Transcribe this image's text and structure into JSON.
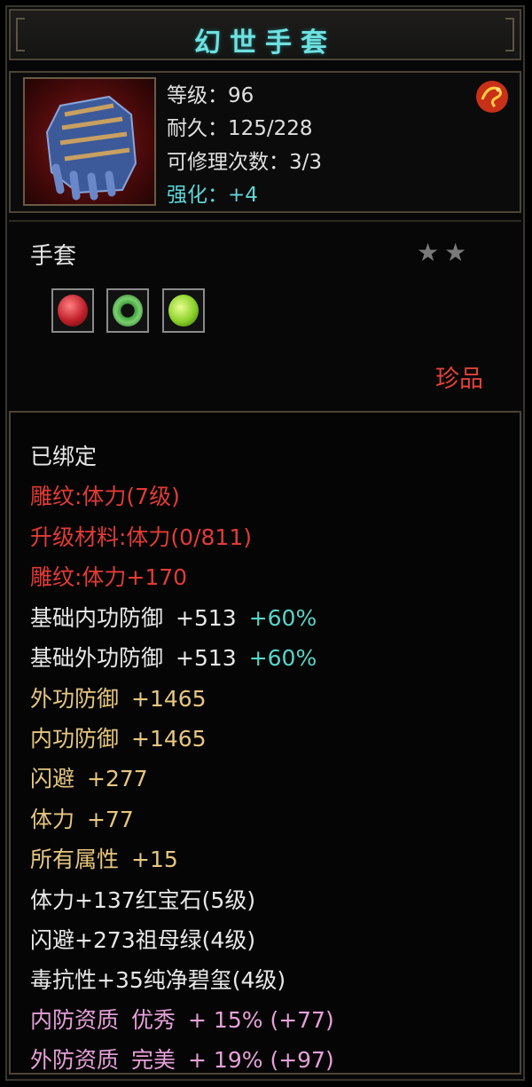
{
  "title": "幻世手套",
  "stats": {
    "level": "等级：96",
    "durability": "耐久：125/228",
    "repairs": "可修理次数：3/3",
    "enhance": "强化：+4"
  },
  "item_type": "手套",
  "stars": "★★",
  "rarity": "珍品",
  "gems": [
    {
      "name": "red-gem-icon",
      "color": "#c0202a"
    },
    {
      "name": "green-ring-gem-icon",
      "color": "#3fa03a"
    },
    {
      "name": "green-gem-icon",
      "color": "#8ad02a"
    }
  ],
  "lines": {
    "bound": "已绑定",
    "engrave1": "雕纹:体力(7级)",
    "upgrade": "升级材料:体力(0/811)",
    "engrave2": "雕纹:体力+170",
    "base_inner_def": {
      "label": "基础内功防御",
      "value": "+513",
      "pct": "+60%"
    },
    "base_outer_def": {
      "label": "基础外功防御",
      "value": "+513",
      "pct": "+60%"
    },
    "outer_def": {
      "label": "外功防御",
      "value": "+1465"
    },
    "inner_def": {
      "label": "内功防御",
      "value": "+1465"
    },
    "dodge": {
      "label": "闪避",
      "value": "+277"
    },
    "stamina": {
      "label": "体力",
      "value": "+77"
    },
    "all_attr": {
      "label": "所有属性",
      "value": "+15"
    },
    "gem1": "体力+137红宝石(5级)",
    "gem2": "闪避+273祖母绿(4级)",
    "gem3": "毒抗性+35纯净碧玺(4级)",
    "inner_quality": {
      "label": "内防资质",
      "grade": "优秀",
      "bonus": "+ 15% (+77)"
    },
    "outer_quality": {
      "label": "外防资质",
      "grade": "完美",
      "bonus": "+ 19% (+97)"
    }
  }
}
